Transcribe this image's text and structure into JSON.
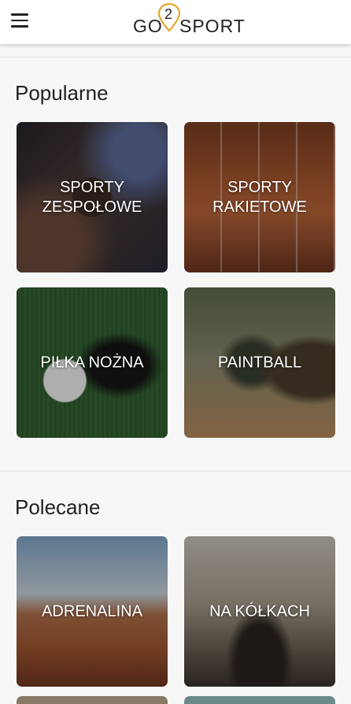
{
  "header": {
    "menu_icon": "hamburger-menu-icon",
    "logo": {
      "left": "GO",
      "center": "2",
      "right": "SPORT",
      "pin_color": "#e4a72c"
    }
  },
  "sections": [
    {
      "title": "Popularne",
      "tiles": [
        {
          "label": "SPORTY\nZESPOŁOWE"
        },
        {
          "label": "SPORTY\nRAKIETOWE"
        },
        {
          "label": "PIŁKA NOŻNA"
        },
        {
          "label": "PAINTBALL"
        }
      ]
    },
    {
      "title": "Polecane",
      "tiles": [
        {
          "label": "ADRENALINA"
        },
        {
          "label": "NA KÓŁKACH"
        }
      ]
    }
  ]
}
